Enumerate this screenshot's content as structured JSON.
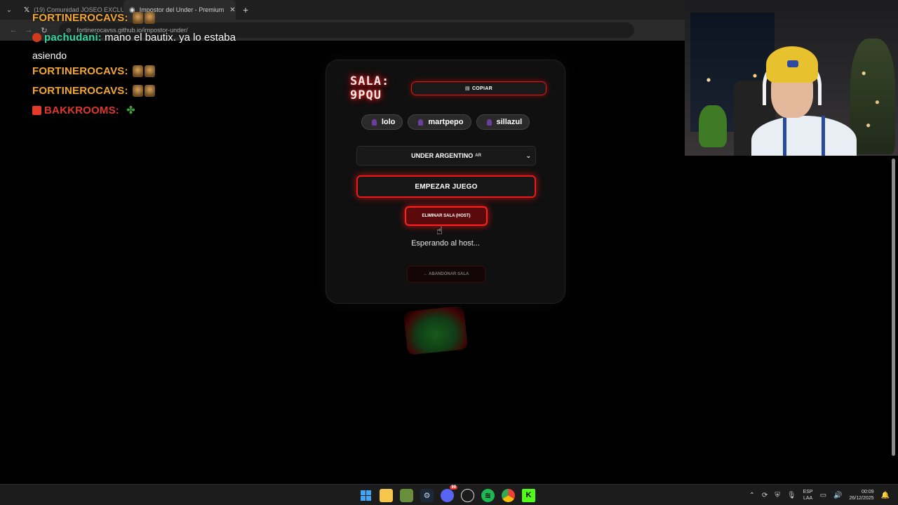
{
  "browser": {
    "tabs": [
      {
        "label": "(19) Comunidad JOSEO EXCLU",
        "icon": "X"
      },
      {
        "label": "Impostor del Under - Premium",
        "icon": "web"
      }
    ],
    "new_tab": "+",
    "url": "fortinerocavss.github.io/impostor-under/"
  },
  "chat": [
    {
      "user": "FORTINEROCAVS:",
      "color": "#f4a833",
      "emotes": 2
    },
    {
      "user": "pachudani:",
      "color": "#35d7a3",
      "message": " mano el bautix. ya lo estaba",
      "wrap": "asiendo"
    },
    {
      "user": "FORTINEROCAVS:",
      "color": "#f4a833",
      "emotes": 2
    },
    {
      "user": "FORTINEROCAVS:",
      "color": "#f4a833",
      "emotes": 2
    },
    {
      "user": "BAKKROOMS:",
      "color": "#e0372c",
      "emote": "leaf"
    }
  ],
  "lobby": {
    "title_line1": "SALA:",
    "title_line2": "9PQU",
    "copy_label": "COPIAR",
    "players": [
      "lolo",
      "martpepo",
      "sillazul"
    ],
    "mode_selected": "UNDER ARGENTINO",
    "mode_flag": "AR",
    "start_label": "EMPEZAR JUEGO",
    "delete_label": "ELIMINAR SALA (HOST)",
    "status": "Esperando al host...",
    "leave_label": "← ABANDONAR SALA"
  },
  "taskbar": {
    "discord_badge": "99",
    "lang_line1": "ESP",
    "lang_line2": "LAA",
    "time": "00:09",
    "date": "26/12/2025"
  },
  "colors": {
    "accent_red": "#e81a1a",
    "card_bg": "#101010",
    "chat_gold": "#f4a833",
    "chat_teal": "#35d7a3"
  }
}
